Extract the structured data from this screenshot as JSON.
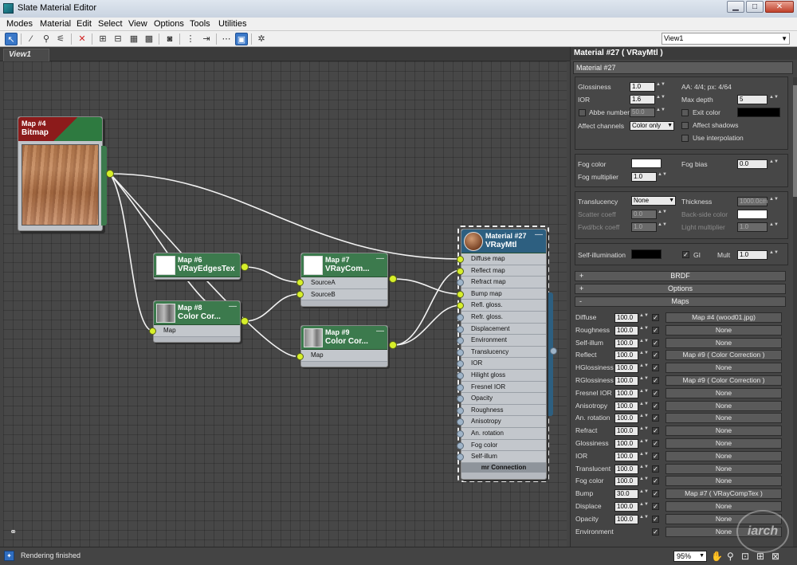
{
  "window": {
    "title": "Slate Material Editor",
    "buttons": {
      "minimize": "▁",
      "maximize": "□",
      "close": "✕"
    }
  },
  "menubar": [
    "Modes",
    "Material",
    "Edit",
    "Select",
    "View",
    "Options",
    "Tools",
    "Utilities"
  ],
  "toolbar": {
    "tools": [
      "select-arrow-icon",
      "eyedropper-icon",
      "assign-icon",
      "eyedropper-remove-icon",
      "delete-icon",
      "layout-all-icon",
      "layout-children-icon",
      "hide-icon",
      "background-icon",
      "show-map-icon",
      "show-end-result-icon",
      "move-children-icon",
      "hide-unused-icon",
      "parameter-editor-icon",
      "material-map-browser-icon"
    ],
    "view_select": "View1"
  },
  "view": {
    "tab": "View1"
  },
  "nodes": {
    "bitmap": {
      "title1": "Map #4",
      "title2": "Bitmap"
    },
    "edges": {
      "title1": "Map #6",
      "title2": "VRayEdgesTex"
    },
    "cc8": {
      "title1": "Map #8",
      "title2": "Color Cor...",
      "slots": [
        "Map"
      ]
    },
    "comp": {
      "title1": "Map #7",
      "title2": "VRayCom...",
      "slots": [
        "SourceA",
        "SourceB"
      ]
    },
    "cc9": {
      "title1": "Map #9",
      "title2": "Color Cor...",
      "slots": [
        "Map"
      ]
    },
    "mtl": {
      "title1": "Material #27",
      "title2": "VRayMtl",
      "slots": [
        "Diffuse map",
        "Reflect map",
        "Refract map",
        "Bump map",
        "Refl. gloss.",
        "Refr. gloss.",
        "Displacement",
        "Environment",
        "Translucency",
        "IOR",
        "Hilight gloss",
        "Fresnel IOR",
        "Opacity",
        "Roughness",
        "Anisotropy",
        "An. rotation",
        "Fog color",
        "Self-illum"
      ],
      "connected": [
        true,
        true,
        false,
        true,
        true,
        false,
        false,
        false,
        false,
        false,
        false,
        false,
        false,
        false,
        false,
        false,
        false,
        false
      ],
      "footer": "mr Connection"
    },
    "minimize_glyph": "—"
  },
  "panel": {
    "header": "Material #27  ( VRayMtl )",
    "name": "Material #27",
    "refraction": {
      "glossiness_label": "Glossiness",
      "glossiness": "1.0",
      "aa_label": "AA: 4/4; px: 4/64",
      "ior_label": "IOR",
      "ior": "1.6",
      "max_depth_label": "Max depth",
      "max_depth": "5",
      "abbe_label": "Abbe number",
      "abbe": "50.0",
      "exit_color_label": "Exit color",
      "affect_channels_label": "Affect channels",
      "affect_channels": "Color only",
      "affect_shadows_label": "Affect shadows",
      "use_interpolation_label": "Use interpolation"
    },
    "fog": {
      "fog_color_label": "Fog color",
      "fog_bias_label": "Fog bias",
      "fog_bias": "0.0",
      "fog_multiplier_label": "Fog multiplier",
      "fog_multiplier": "1.0"
    },
    "translucency": {
      "label": "Translucency",
      "value": "None",
      "thickness_label": "Thickness",
      "thickness": "1000.0cm",
      "scatter_label": "Scatter coeff",
      "scatter": "0.0",
      "backside_label": "Back-side color",
      "fwdbck_label": "Fwd/bck coeff",
      "fwdbck": "1.0",
      "light_mult_label": "Light multiplier",
      "light_mult": "1.0"
    },
    "self_illum": {
      "label": "Self-illumination",
      "gi_label": "GI",
      "mult_label": "Mult",
      "mult": "1.0"
    },
    "rollouts": {
      "brdf": "BRDF",
      "options": "Options",
      "maps": "Maps",
      "plus": "+",
      "minus": "-"
    },
    "maps": [
      {
        "name": "Diffuse",
        "amount": "100.0",
        "map": "Map #4 (wood01.jpg)"
      },
      {
        "name": "Roughness",
        "amount": "100.0",
        "map": "None"
      },
      {
        "name": "Self-illum",
        "amount": "100.0",
        "map": "None"
      },
      {
        "name": "Reflect",
        "amount": "100.0",
        "map": "Map #9  ( Color Correction )"
      },
      {
        "name": "HGlossiness",
        "amount": "100.0",
        "map": "None"
      },
      {
        "name": "RGlossiness",
        "amount": "100.0",
        "map": "Map #9  ( Color Correction )"
      },
      {
        "name": "Fresnel IOR",
        "amount": "100.0",
        "map": "None"
      },
      {
        "name": "Anisotropy",
        "amount": "100.0",
        "map": "None"
      },
      {
        "name": "An. rotation",
        "amount": "100.0",
        "map": "None"
      },
      {
        "name": "Refract",
        "amount": "100.0",
        "map": "None"
      },
      {
        "name": "Glossiness",
        "amount": "100.0",
        "map": "None"
      },
      {
        "name": "IOR",
        "amount": "100.0",
        "map": "None"
      },
      {
        "name": "Translucent",
        "amount": "100.0",
        "map": "None"
      },
      {
        "name": "Fog color",
        "amount": "100.0",
        "map": "None"
      },
      {
        "name": "Bump",
        "amount": "30.0",
        "map": "Map #7  ( VRayCompTex )"
      },
      {
        "name": "Displace",
        "amount": "100.0",
        "map": "None"
      },
      {
        "name": "Opacity",
        "amount": "100.0",
        "map": "None"
      },
      {
        "name": "Environment",
        "amount": "",
        "map": "None"
      }
    ],
    "check_glyph": "✓",
    "arrow_glyph": "▼",
    "spin_glyph": "▲▼"
  },
  "status": {
    "text": "Rendering finished",
    "zoom": "95%"
  },
  "watermark": "iarch",
  "colors": {
    "node_green": "#3c7a4d",
    "node_blue": "#2d5f80",
    "socket_yellow": "#d7ef2a",
    "wire": "#f2f2f2",
    "bitmap_red": "#8c1b1b"
  }
}
